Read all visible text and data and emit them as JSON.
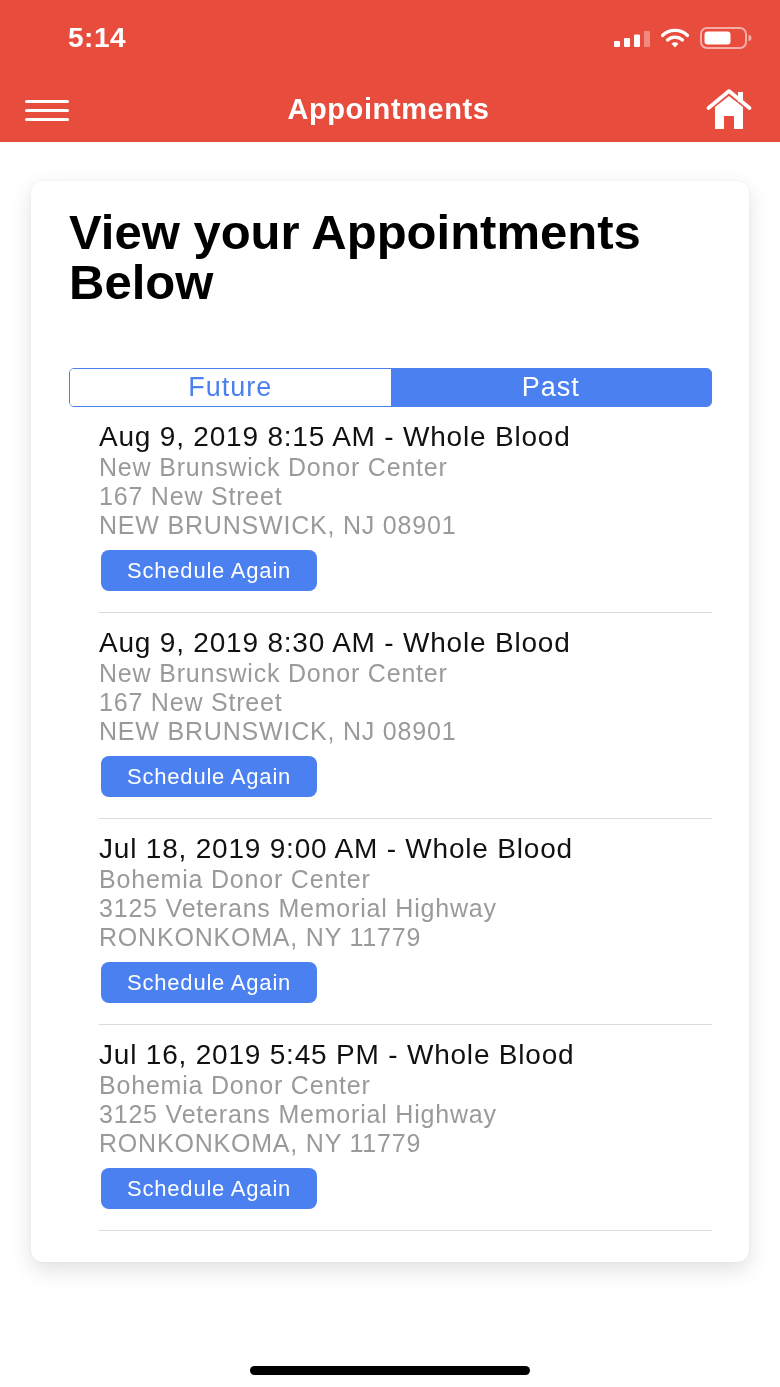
{
  "status_bar": {
    "time": "5:14"
  },
  "nav_bar": {
    "title": "Appointments"
  },
  "card": {
    "heading": "View your Appointments Below",
    "segments": [
      {
        "label": "Future",
        "selected": false
      },
      {
        "label": "Past",
        "selected": true
      }
    ],
    "appointments": [
      {
        "title": "Aug 9, 2019 8:15 AM - Whole Blood",
        "center": "New Brunswick Donor Center",
        "street": "167 New Street",
        "city": "NEW BRUNSWICK, NJ 08901",
        "button": "Schedule Again"
      },
      {
        "title": "Aug 9, 2019 8:30 AM - Whole Blood",
        "center": "New Brunswick Donor Center",
        "street": "167 New Street",
        "city": "NEW BRUNSWICK, NJ 08901",
        "button": "Schedule Again"
      },
      {
        "title": "Jul 18, 2019 9:00 AM - Whole Blood",
        "center": "Bohemia Donor Center",
        "street": "3125 Veterans Memorial Highway",
        "city": "RONKONKOMA, NY 11779",
        "button": "Schedule Again"
      },
      {
        "title": "Jul 16, 2019 5:45 PM - Whole Blood",
        "center": "Bohemia Donor Center",
        "street": "3125 Veterans Memorial Highway",
        "city": "RONKONKOMA, NY 11779",
        "button": "Schedule Again"
      }
    ]
  }
}
